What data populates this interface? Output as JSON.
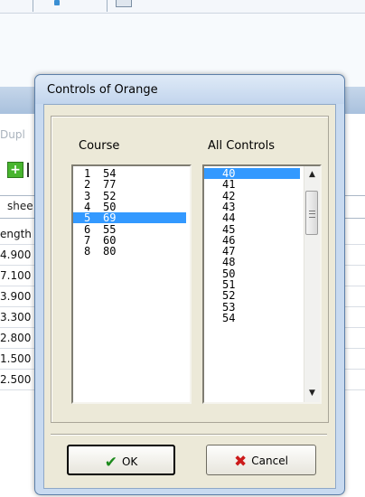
{
  "background": {
    "partial_labels": [
      "Dupl",
      "shee",
      "ength"
    ],
    "values": [
      "4.900",
      "7.100",
      "3.900",
      "3.300",
      "2.800",
      "1.500",
      "2.500"
    ]
  },
  "dialog": {
    "title": "Controls of Orange",
    "course_label": "Course",
    "all_controls_label": "All Controls",
    "course_items": [
      {
        "n": "1",
        "code": "54"
      },
      {
        "n": "2",
        "code": "77"
      },
      {
        "n": "3",
        "code": "52"
      },
      {
        "n": "4",
        "code": "50"
      },
      {
        "n": "5",
        "code": "69",
        "selected": true
      },
      {
        "n": "6",
        "code": "55"
      },
      {
        "n": "7",
        "code": "60"
      },
      {
        "n": "8",
        "code": "80"
      }
    ],
    "all_controls_items": [
      "40",
      "41",
      "42",
      "43",
      "44",
      "45",
      "46",
      "47",
      "48",
      "50",
      "51",
      "52",
      "53",
      "54"
    ],
    "all_controls_selected": "40",
    "ok_label": "OK",
    "cancel_label": "Cancel"
  }
}
